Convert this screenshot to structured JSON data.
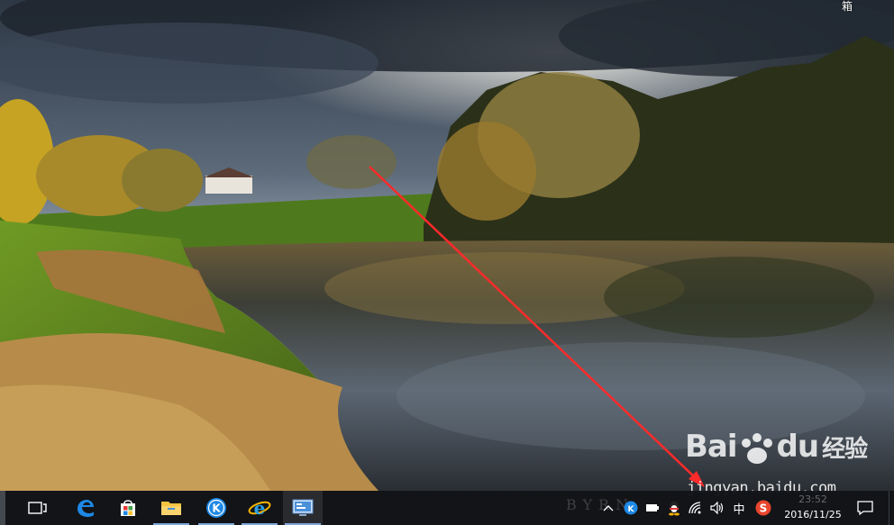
{
  "desktop": {
    "corner_text": "箱",
    "wallpaper": "lake-landscape"
  },
  "watermark": {
    "logo_text": "Bai",
    "logo_text2": "du",
    "logo_text3": "经验",
    "url": "jingyan.baidu.com"
  },
  "taskbar": {
    "background_brand_text": "BYRN",
    "apps": [
      {
        "name": "task-view",
        "icon": "task-view-icon"
      },
      {
        "name": "edge",
        "icon": "edge-icon"
      },
      {
        "name": "store",
        "icon": "store-icon"
      },
      {
        "name": "file-explorer",
        "icon": "folder-icon"
      },
      {
        "name": "kugou",
        "icon": "kugou-icon"
      },
      {
        "name": "internet-explorer",
        "icon": "ie-icon"
      },
      {
        "name": "control-panel",
        "icon": "control-panel-icon"
      }
    ],
    "tray": {
      "ime": "中",
      "time": "23:52",
      "date": "2016/11/25"
    }
  },
  "colors": {
    "arrow": "#ff2a2a",
    "taskbar": "#121418",
    "accent": "#1e88e5"
  }
}
